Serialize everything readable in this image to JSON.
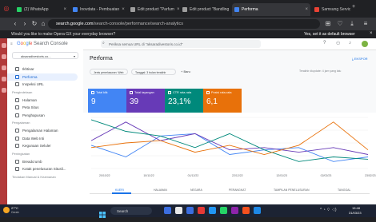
{
  "browser": {
    "tabs": [
      {
        "label": "(2) WhatsApp",
        "favicon_color": "#25d366",
        "active": false
      },
      {
        "label": "Inovdata - Pembuatan",
        "favicon_color": "#4285f4",
        "active": false
      },
      {
        "label": "Edit product \"Parfum",
        "favicon_color": "#9e9e9e",
        "active": false
      },
      {
        "label": "Edit product \"Bandling",
        "favicon_color": "#9e9e9e",
        "active": false
      },
      {
        "label": "Performa",
        "favicon_color": "#4285f4",
        "active": true
      },
      {
        "label": "Samsung Service Cent",
        "favicon_color": "#ea4335",
        "active": false
      }
    ],
    "url_prefix": "search.google.com",
    "url_rest": "/search-console/performance/search-analytics",
    "infobar": {
      "text": "Would you like to make Opera GX your everyday browser?",
      "link": "Yes, set it as default browser"
    }
  },
  "gsc": {
    "logo": "Google Search Console",
    "property": "aksaradivestoris.co...",
    "search_placeholder": "Periksa semua URL di \"aksaradivestoris.co.id\"",
    "page_title": "Performa",
    "export_label": "EKSPOR",
    "last_update": "Terakhir diupdate: 4 jam yang lalu",
    "filters": [
      "Jenis penelusuran: Web",
      "Tanggal: 3 bulan terakhir"
    ],
    "new_filter": "Baru",
    "sidebar": [
      {
        "type": "item",
        "label": "Ikhtisar",
        "icon": "home-icon"
      },
      {
        "type": "item",
        "label": "Performa",
        "icon": "chart-icon",
        "selected": true
      },
      {
        "type": "item",
        "label": "Inspeksi URL",
        "icon": "search-icon"
      },
      {
        "type": "section",
        "label": "Pengindeksan"
      },
      {
        "type": "item",
        "label": "Halaman",
        "icon": "page-icon"
      },
      {
        "type": "item",
        "label": "Peta Situs",
        "icon": "sitemap-icon"
      },
      {
        "type": "item",
        "label": "Penghapusan",
        "icon": "remove-icon"
      },
      {
        "type": "section",
        "label": "Pengalaman"
      },
      {
        "type": "item",
        "label": "Pengalaman Halaman",
        "icon": "star-icon"
      },
      {
        "type": "item",
        "label": "Data Web Inti",
        "icon": "speed-icon"
      },
      {
        "type": "item",
        "label": "Kegunaan Seluler",
        "icon": "phone-icon"
      },
      {
        "type": "section",
        "label": "Peningkatan"
      },
      {
        "type": "item",
        "label": "Breadcrumb",
        "icon": "breadcrumb-icon"
      },
      {
        "type": "item",
        "label": "Kotak penelusuran Situsli...",
        "icon": "searchbox-icon"
      },
      {
        "type": "section",
        "label": "Tindakan Manual & Keamanan"
      }
    ],
    "metrics": [
      {
        "label": "Total klik",
        "value": "9",
        "color": "#4285f4"
      },
      {
        "label": "Total tayangan",
        "value": "39",
        "color": "#673ab7"
      },
      {
        "label": "CTR rata-rata",
        "value": "23,1%",
        "color": "#00897b"
      },
      {
        "label": "Posisi rata-rata",
        "value": "6,1",
        "color": "#e8710a"
      }
    ],
    "bottom_tabs": [
      "KUERI",
      "HALAMAN",
      "NEGARA",
      "PERANGKAT",
      "TAMPILAN PENELUSURAN",
      "TANGGAL"
    ]
  },
  "chart_data": {
    "type": "line",
    "x": [
      "20/10/22",
      "10/11/22",
      "01/12/22",
      "22/12/22",
      "12/01/23",
      "02/02/23",
      "23/02/23"
    ],
    "series": [
      {
        "color": "#4285f4",
        "values": [
          1,
          0.5,
          1.4,
          1.5,
          0.6,
          0.8,
          0.9,
          0.3,
          0.5
        ]
      },
      {
        "color": "#673ab7",
        "values": [
          1.2,
          2.0,
          1.2,
          1.5,
          0.8,
          0.9,
          0.7,
          0.9,
          0.6
        ]
      },
      {
        "color": "#00897b",
        "values": [
          2.1,
          1.6,
          1.4,
          0.9,
          1.5,
          0.8,
          0.3,
          0.5,
          0.4
        ]
      },
      {
        "color": "#e8710a",
        "values": [
          0.9,
          1.1,
          1.2,
          0.7,
          1.0,
          0.6,
          1.0,
          2.0,
          0.8
        ]
      }
    ]
  },
  "taskbar": {
    "weather_temp": "27°C",
    "weather_text": "Cerah",
    "search_label": "Search",
    "time": "15:48",
    "date": "31/03/23"
  }
}
